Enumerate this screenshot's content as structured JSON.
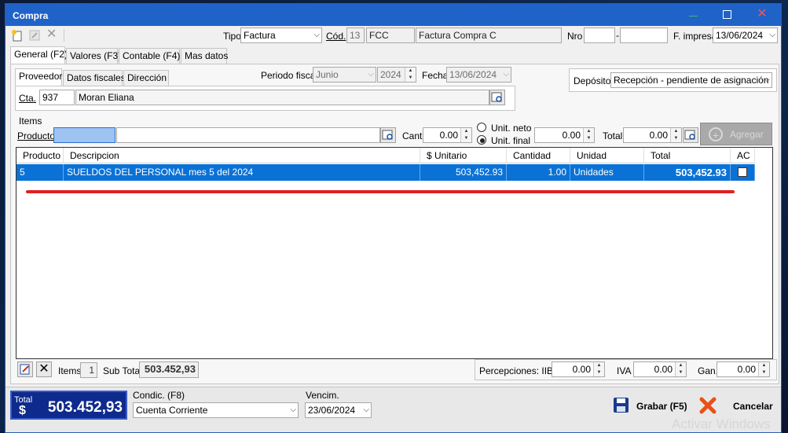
{
  "window": {
    "title": "Compra"
  },
  "toolbar": {
    "tipo_label": "Tipo",
    "tipo_value": "Factura",
    "cod_label": "Cód.",
    "cod_num": "13",
    "cod_code": "FCC",
    "cod_desc": "Factura Compra C",
    "nro_label": "Nro",
    "nro_sep": "-",
    "fimpresa_label": "F. impresa",
    "fimpresa_value": "13/06/2024"
  },
  "tabs": [
    "General (F2)",
    "Valores (F3)",
    "Contable (F4)",
    "Mas datos"
  ],
  "subtabs": [
    "Proveedor",
    "Datos fiscales",
    "Dirección"
  ],
  "proveedor": {
    "cta_label": "Cta.",
    "cta_value": "937",
    "name": "Moran Eliana"
  },
  "periodo": {
    "label": "Periodo fiscal",
    "month": "Junio",
    "year": "2024",
    "fecha_label": "Fecha",
    "fecha_value": "13/06/2024"
  },
  "deposito": {
    "label": "Depósito",
    "value": "Recepción - pendiente de asignación"
  },
  "items": {
    "group_label": "Items",
    "producto_label": "Producto",
    "cant_label": "Cant.",
    "cant_value": "0.00",
    "radio_neto": "Unit. neto",
    "radio_final": "Unit. final",
    "unit_value": "0.00",
    "total_label": "Total",
    "total_value": "0.00",
    "agregar_label": "Agregar"
  },
  "table": {
    "headers": [
      "Producto",
      "Descripcion",
      "$ Unitario",
      "Cantidad",
      "Unidad",
      "Total",
      "AC"
    ],
    "rows": [
      {
        "producto": "5",
        "descripcion": "SUELDOS DEL PERSONAL mes 5 del 2024",
        "unitario": "503,452.93",
        "cantidad": "1.00",
        "unidad": "Unidades",
        "total": "503,452.93",
        "ac": false
      }
    ]
  },
  "footer": {
    "items_label": "Items",
    "items_count": "1",
    "subtotal_label": "Sub Total",
    "subtotal_value": "503.452,93",
    "perc_label": "Percepciones: IIBB",
    "perc_value": "0.00",
    "iva_label": "IVA",
    "iva_value": "0.00",
    "gan_label": "Gan.",
    "gan_value": "0.00"
  },
  "bottom": {
    "total_label": "Total",
    "total_currency": "$",
    "total_value": "503.452,93",
    "condic_label": "Condic. (F8)",
    "condic_value": "Cuenta Corriente",
    "vencim_label": "Vencim.",
    "vencim_value": "23/06/2024",
    "grabar_label": "Grabar (F5)",
    "cancelar_label": "Cancelar"
  },
  "watermark": "Activar Windows",
  "colors": {
    "titlebar": "#1f63c9",
    "selection": "#0a72d6",
    "accent_red": "#e02020",
    "total_panel": "#0e2a8c"
  }
}
